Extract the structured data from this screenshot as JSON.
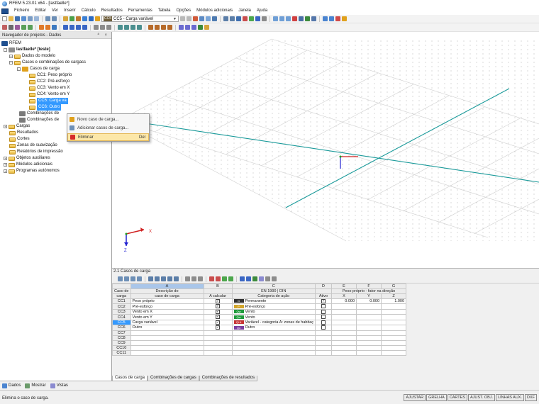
{
  "window": {
    "title": "RFEM 5.23.01 x64 - [lastfaelle*]"
  },
  "menu": [
    "Ficheiro",
    "Editar",
    "Ver",
    "Inserir",
    "Cálculo",
    "Resultados",
    "Ferramentas",
    "Tabela",
    "Opções",
    "Módulos adicionais",
    "Janela",
    "Ajuda"
  ],
  "toolbar": {
    "load_case_tag": "CC5",
    "load_case_value": "CC5 - Carga variável"
  },
  "navigator": {
    "title": "Navegador de projetos - Dados",
    "tree": [
      {
        "label": "RFEM",
        "depth": 0,
        "icon": "app"
      },
      {
        "label": "lastfaelle* [teste]",
        "depth": 1,
        "icon": "project",
        "bold": true
      },
      {
        "label": "Dados do modelo",
        "depth": 2,
        "icon": "folder"
      },
      {
        "label": "Casos e combinações de cargass",
        "depth": 2,
        "icon": "folder"
      },
      {
        "label": "Casos de carga",
        "depth": 3,
        "icon": "load-cases"
      },
      {
        "label": "CC1: Peso próprio",
        "depth": 4,
        "icon": "folder"
      },
      {
        "label": "CC2: Pré-esforço",
        "depth": 4,
        "icon": "folder"
      },
      {
        "label": "CC3: Vento em X",
        "depth": 4,
        "icon": "folder"
      },
      {
        "label": "CC4: Vento em Y",
        "depth": 4,
        "icon": "folder"
      },
      {
        "label": "CC5: Carga va",
        "depth": 4,
        "icon": "folder",
        "selected": true
      },
      {
        "label": "CC6: Outro",
        "depth": 4,
        "icon": "folder",
        "selected": true
      },
      {
        "label": "Combinações de",
        "depth": 3,
        "icon": "combo"
      },
      {
        "label": "Combinações de",
        "depth": 3,
        "icon": "combo"
      },
      {
        "label": "Cargas",
        "depth": 1,
        "icon": "folder"
      },
      {
        "label": "Resultados",
        "depth": 1,
        "icon": "folder"
      },
      {
        "label": "Cortes",
        "depth": 1,
        "icon": "folder"
      },
      {
        "label": "Zonas de suavização",
        "depth": 1,
        "icon": "folder"
      },
      {
        "label": "Relatórios de impressão",
        "depth": 1,
        "icon": "folder"
      },
      {
        "label": "Objetos auxiliares",
        "depth": 1,
        "icon": "folder"
      },
      {
        "label": "Módulos adicionais",
        "depth": 1,
        "icon": "folder"
      },
      {
        "label": "Programas autónomos",
        "depth": 1,
        "icon": "folder"
      }
    ],
    "tabs": [
      "Dados",
      "Mostrar",
      "Vistas"
    ]
  },
  "context_menu": {
    "items": [
      {
        "label": "Novo caso de carga...",
        "shortcut": ""
      },
      {
        "label": "Adicionar casos de carga...",
        "shortcut": ""
      },
      {
        "label": "Eliminar",
        "shortcut": "Del",
        "highlighted": true
      }
    ]
  },
  "table": {
    "title": "2.1 Casos de carga",
    "letters": [
      "A",
      "B",
      "C",
      "D",
      "E",
      "F",
      "G"
    ],
    "headers_top": [
      "Caso de",
      "Descrição do",
      "",
      "EN 1990 | DIN",
      "",
      "Peso próprio - fator na direção",
      "",
      ""
    ],
    "headers_bottom": [
      "carga",
      "caso de carga",
      "A calcular",
      "Categoria de ação",
      "Ativo",
      "X",
      "Y",
      "Z"
    ],
    "rows": [
      {
        "id": "CC1",
        "desc": "Peso próprio",
        "calc": true,
        "cat_code": "G",
        "cat_color": "#2f2f2f",
        "category": "Permanente",
        "active": true,
        "x": "0.000",
        "y": "0.000",
        "z": "1.000"
      },
      {
        "id": "CC2",
        "desc": "Pré-esforço",
        "calc": true,
        "cat_code": "P",
        "cat_color": "#d2a52a",
        "category": "Pré-esforço",
        "active": false,
        "x": "",
        "y": "",
        "z": ""
      },
      {
        "id": "CC3",
        "desc": "Vento em X",
        "calc": true,
        "cat_code": "Qw",
        "cat_color": "#1e9a3b",
        "category": "Vento",
        "active": false,
        "x": "",
        "y": "",
        "z": ""
      },
      {
        "id": "CC4",
        "desc": "Vento em Y",
        "calc": true,
        "cat_code": "Qw",
        "cat_color": "#1e9a3b",
        "category": "Vento",
        "active": false,
        "x": "",
        "y": "",
        "z": ""
      },
      {
        "id": "CC5",
        "desc": "Carga variável",
        "calc": true,
        "cat_code": "Qi A",
        "cat_color": "#c83434",
        "category": "Variável - categoria A: zonas de habitaç",
        "active": false,
        "x": "",
        "y": "",
        "z": "",
        "selected": true
      },
      {
        "id": "CC6",
        "desc": "Outro",
        "calc": true,
        "cat_code": "Qo",
        "cat_color": "#7a3fa0",
        "category": "Outro",
        "active": false,
        "x": "",
        "y": "",
        "z": ""
      },
      {
        "id": "CC7",
        "desc": "",
        "calc": null,
        "cat_code": "",
        "category": "",
        "active": null,
        "x": "",
        "y": "",
        "z": ""
      },
      {
        "id": "CC8",
        "desc": "",
        "calc": null,
        "cat_code": "",
        "category": "",
        "active": null,
        "x": "",
        "y": "",
        "z": ""
      },
      {
        "id": "CC9",
        "desc": "",
        "calc": null,
        "cat_code": "",
        "category": "",
        "active": null,
        "x": "",
        "y": "",
        "z": ""
      },
      {
        "id": "CC10",
        "desc": "",
        "calc": null,
        "cat_code": "",
        "category": "",
        "active": null,
        "x": "",
        "y": "",
        "z": ""
      },
      {
        "id": "CC11",
        "desc": "",
        "calc": null,
        "cat_code": "",
        "category": "",
        "active": null,
        "x": "",
        "y": "",
        "z": ""
      }
    ],
    "tabs": [
      "Casos de carga",
      "Combinações de cargas",
      "Combinações de resultados"
    ]
  },
  "status": {
    "text": "Elimina o caso de carga.",
    "buttons": [
      "AJUSTAR",
      "GRELHA",
      "CARTES",
      "AJUST. OBJ.",
      "LINHAS AUX.",
      "DXF"
    ]
  },
  "viewport": {
    "axes_labels": [
      "X",
      "Z"
    ]
  }
}
